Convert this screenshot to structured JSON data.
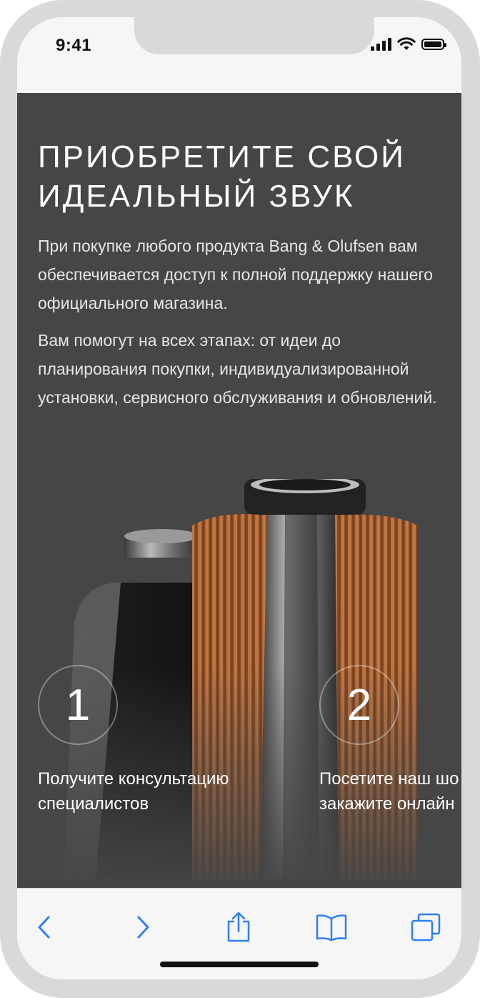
{
  "status_bar": {
    "time": "9:41",
    "icons": [
      "cellular-signal-icon",
      "wifi-icon",
      "battery-icon"
    ]
  },
  "hero": {
    "title_line1": "ПРИОБРЕТИТЕ СВОЙ",
    "title_line2": "ИДЕАЛЬНЫЙ ЗВУК",
    "paragraph_1": "При покупке любого продукта Bang & Olufsen вам обеспечивается доступ к полной поддержку нашего официального магазина.",
    "paragraph_2": "Вам помогут на всех этапах: от идеи до планирования покупки, индивидуализированной установки, сервисного обслуживания и обновлений."
  },
  "steps": [
    {
      "number": "1",
      "line1": "Получите консультацию",
      "line2": "специалистов"
    },
    {
      "number": "2",
      "line1": "Посетите наш шо",
      "line2": "закажите онлайн"
    }
  ],
  "toolbar": {
    "items": [
      "back-icon",
      "forward-icon",
      "share-icon",
      "bookmarks-icon",
      "tabs-icon"
    ]
  },
  "colors": {
    "content_bg": "#464646",
    "toolbar_accent": "#2f7ef5",
    "speaker_copper": "#b46a3a"
  }
}
